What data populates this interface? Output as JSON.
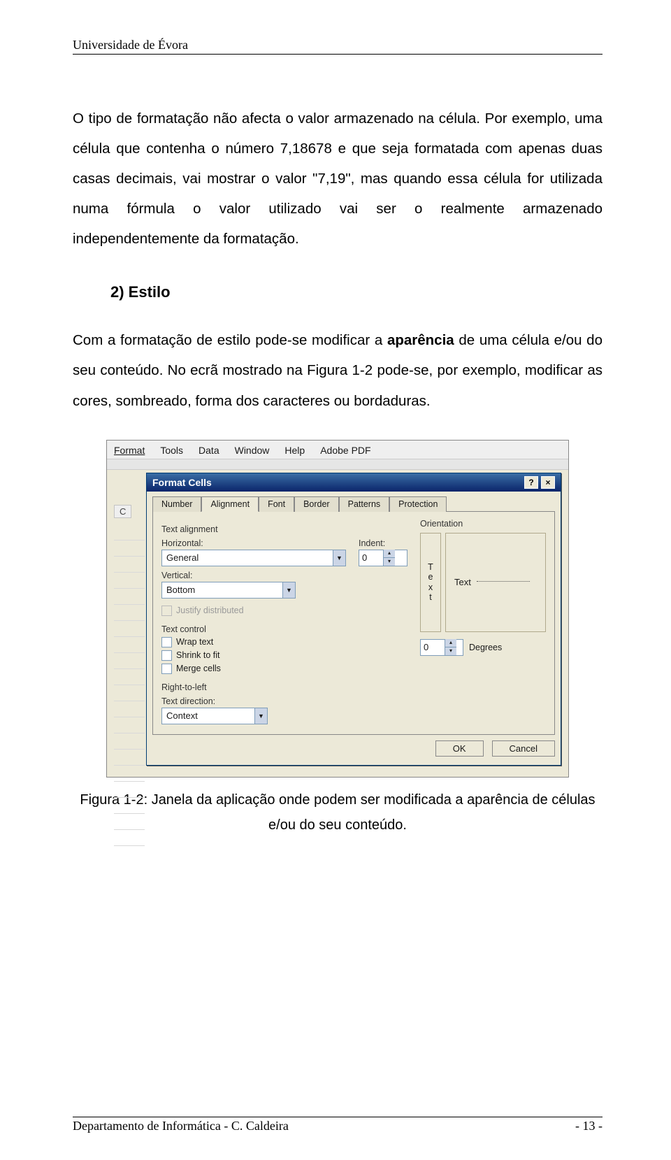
{
  "header": {
    "university": "Universidade de Évora"
  },
  "body": {
    "p1": "O tipo de formatação não afecta o valor armazenado na célula. Por exemplo, uma célula que contenha o número 7,18678 e que seja formatada com apenas duas casas decimais, vai mostrar o valor \"7,19\", mas quando essa célula for utilizada numa fórmula o valor utilizado vai ser o realmente armazenado independentemente da formatação.",
    "heading": "2) Estilo",
    "p2_a": "Com a formatação de estilo pode-se modificar a ",
    "p2_b_bold": "aparência",
    "p2_c": " de uma célula e/ou do seu conteúdo. No ecrã mostrado na Figura 1-2 pode-se, por exemplo, modificar as cores, sombreado, forma dos caracteres ou bordaduras."
  },
  "figure": {
    "menu": {
      "format": "Format",
      "tools": "Tools",
      "data": "Data",
      "window": "Window",
      "help": "Help",
      "adobe": "Adobe PDF"
    },
    "colLetter": "C",
    "dialog": {
      "title": "Format Cells",
      "help": "?",
      "close": "×",
      "tabs": {
        "number": "Number",
        "alignment": "Alignment",
        "font": "Font",
        "border": "Border",
        "patterns": "Patterns",
        "protection": "Protection"
      },
      "groups": {
        "textAlign": "Text alignment",
        "orientation": "Orientation",
        "textControl": "Text control",
        "rtl": "Right-to-left"
      },
      "labels": {
        "horizontal": "Horizontal:",
        "vertical": "Vertical:",
        "indent": "Indent:",
        "textDirection": "Text direction:",
        "degrees": "Degrees"
      },
      "values": {
        "horizontal": "General",
        "vertical": "Bottom",
        "indent": "0",
        "degrees": "0",
        "textDirection": "Context"
      },
      "checks": {
        "justify": "Justify distributed",
        "wrap": "Wrap text",
        "shrink": "Shrink to fit",
        "merge": "Merge cells"
      },
      "orient": {
        "v": "T\ne\nx\nt",
        "h": "Text"
      },
      "buttons": {
        "ok": "OK",
        "cancel": "Cancel"
      }
    },
    "caption": "Figura 1-2: Janela da aplicação onde podem ser modificada a aparência de células e/ou do seu conteúdo."
  },
  "footer": {
    "dept": "Departamento de Informática - C. Caldeira",
    "page": "- 13 -"
  }
}
